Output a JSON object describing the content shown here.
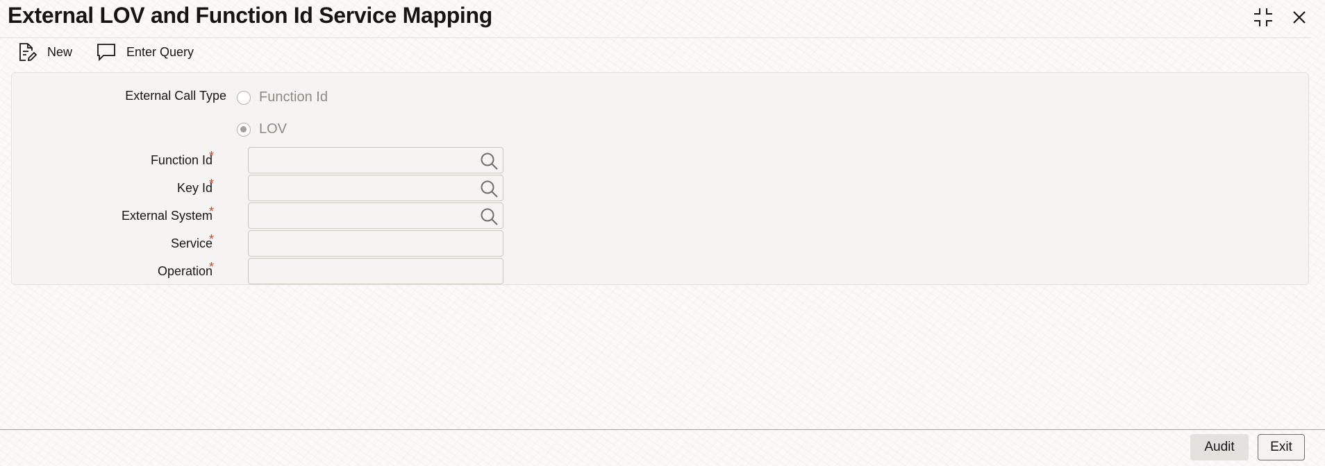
{
  "window": {
    "title": "External LOV and Function Id Service Mapping",
    "controls": [
      "collapse-icon",
      "close-icon"
    ]
  },
  "toolbar": {
    "new_label": "New",
    "enter_query_label": "Enter Query"
  },
  "form": {
    "external_call_type": {
      "label": "External Call Type",
      "options": [
        {
          "label": "Function Id",
          "checked": false
        },
        {
          "label": "LOV",
          "checked": true
        }
      ]
    },
    "function_id": {
      "label": "Function Id",
      "required_mark": "*",
      "value": ""
    },
    "key_id": {
      "label": "Key Id",
      "required_mark": "*",
      "value": ""
    },
    "external_system": {
      "label": "External System",
      "required_mark": "*",
      "value": ""
    },
    "service": {
      "label": "Service",
      "required_mark": "*",
      "value": ""
    },
    "operation": {
      "label": "Operation",
      "required_mark": "*",
      "value": ""
    }
  },
  "footer": {
    "audit_label": "Audit",
    "exit_label": "Exit"
  },
  "colors": {
    "required": "#c74634",
    "panel_bg": "#f6f4f2",
    "text": "#161513"
  }
}
